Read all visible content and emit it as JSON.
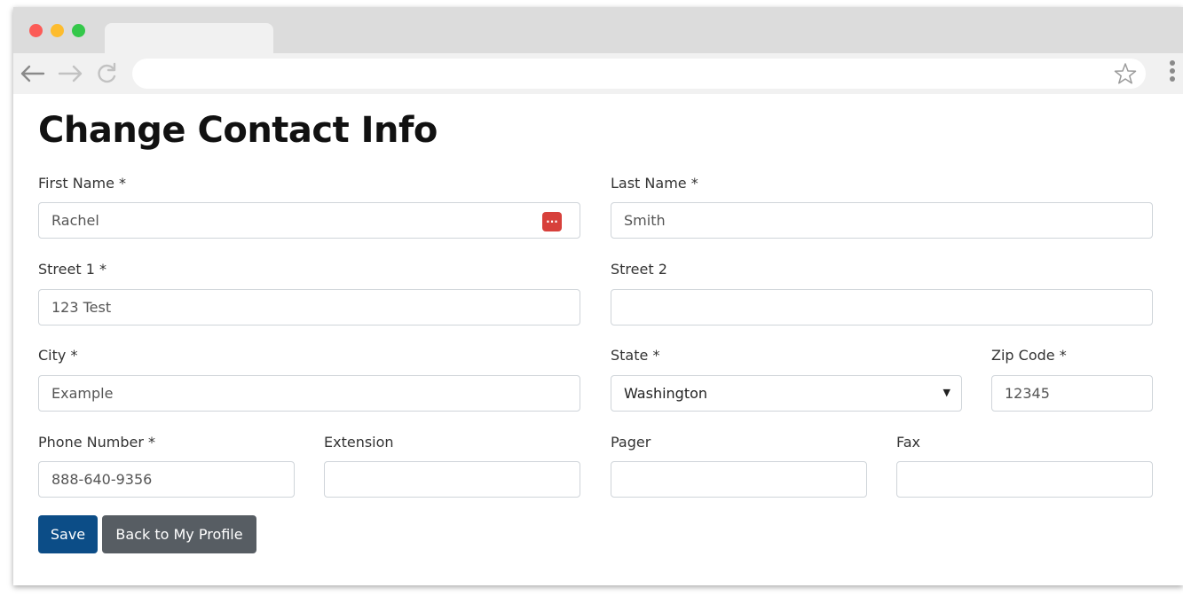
{
  "page": {
    "title": "Change Contact Info"
  },
  "form": {
    "first_name": {
      "label": "First Name *",
      "value": "Rachel"
    },
    "last_name": {
      "label": "Last Name *",
      "value": "Smith"
    },
    "street1": {
      "label": "Street 1 *",
      "value": "123 Test"
    },
    "street2": {
      "label": "Street 2",
      "value": ""
    },
    "city": {
      "label": "City *",
      "value": "Example"
    },
    "state": {
      "label": "State *",
      "value": "Washington"
    },
    "zip": {
      "label": "Zip Code *",
      "value": "12345"
    },
    "phone": {
      "label": "Phone Number *",
      "value": "888-640-9356"
    },
    "extension": {
      "label": "Extension",
      "value": ""
    },
    "pager": {
      "label": "Pager",
      "value": ""
    },
    "fax": {
      "label": "Fax",
      "value": ""
    }
  },
  "buttons": {
    "save_label": "Save",
    "back_label": "Back to My Profile"
  },
  "icons": {
    "password_manager": "password-manager-icon",
    "back": "arrow-left-icon",
    "forward": "arrow-right-icon",
    "reload": "reload-icon",
    "bookmark": "star-icon",
    "menu": "kebab-menu-icon"
  },
  "colors": {
    "primary": "#0c4d87",
    "secondary": "#575d63",
    "password_manager": "#d7403b"
  }
}
